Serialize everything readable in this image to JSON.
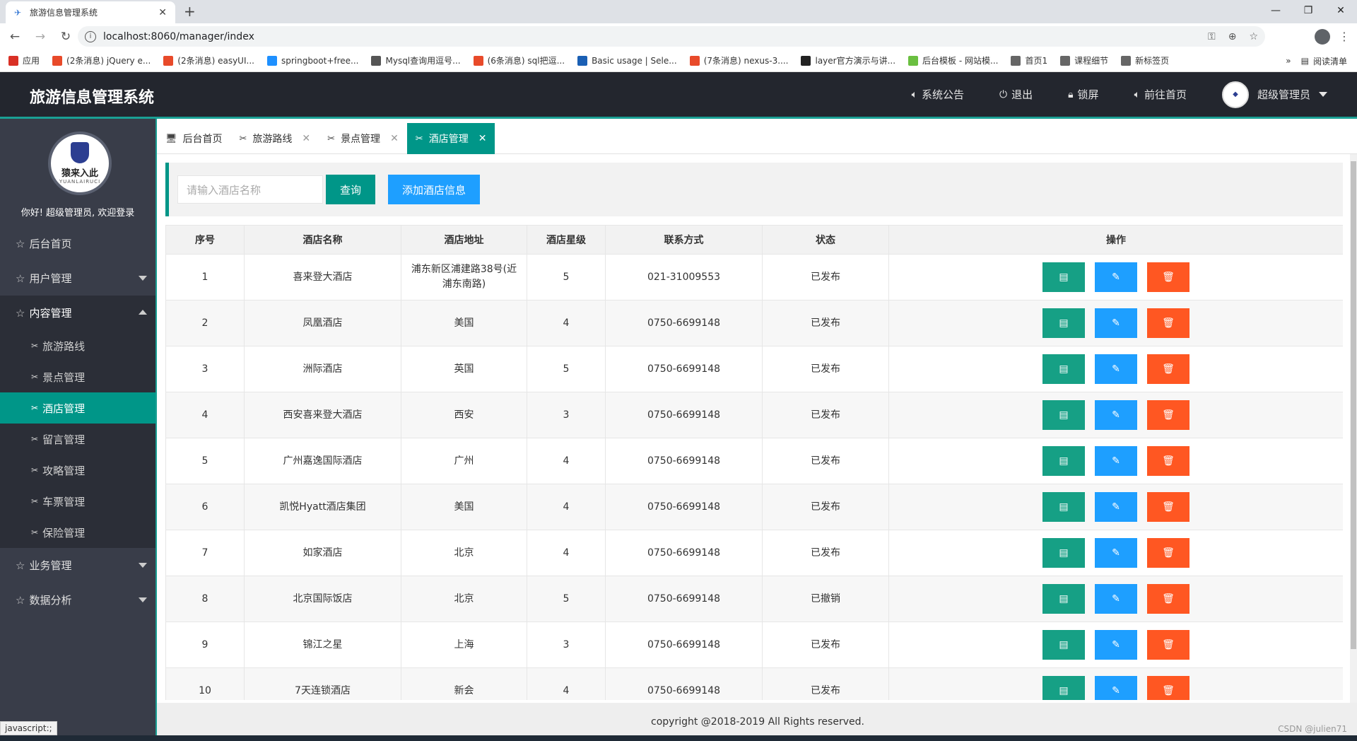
{
  "browser": {
    "tab_title": "旅游信息管理系统",
    "url": "localhost:8060/manager/index",
    "bookmarks": [
      {
        "icon": "apps-icon",
        "label": "应用",
        "color": "#d93025"
      },
      {
        "icon": "c-icon",
        "label": "(2条消息) jQuery e...",
        "color": "#e84a2a"
      },
      {
        "icon": "c-icon",
        "label": "(2条消息) easyUI...",
        "color": "#e84a2a"
      },
      {
        "icon": "tv-icon",
        "label": "springboot+free...",
        "color": "#1e90ff"
      },
      {
        "icon": "dolphin-icon",
        "label": "Mysql查询用逗号...",
        "color": "#555555"
      },
      {
        "icon": "c-icon",
        "label": "(6条消息) sql把逗...",
        "color": "#e84a2a"
      },
      {
        "icon": "stack-icon",
        "label": "Basic usage | Sele...",
        "color": "#1a5fb4"
      },
      {
        "icon": "c-icon",
        "label": "(7条消息) nexus-3....",
        "color": "#e84a2a"
      },
      {
        "icon": "layer-icon",
        "label": "layer官方演示与讲...",
        "color": "#222222"
      },
      {
        "icon": "m-icon",
        "label": "后台模板 - 网站模...",
        "color": "#6abf40"
      },
      {
        "icon": "globe-icon",
        "label": "首页1",
        "color": "#666666"
      },
      {
        "icon": "globe-icon",
        "label": "课程细节",
        "color": "#666666"
      },
      {
        "icon": "globe-icon",
        "label": "新标签页",
        "color": "#666666"
      }
    ],
    "reading_list": "阅读清单",
    "status_text": "javascript:;",
    "watermark": "CSDN @julien71"
  },
  "header": {
    "title": "旅游信息管理系统",
    "nav": [
      {
        "icon": "speaker-icon",
        "label": "系统公告"
      },
      {
        "icon": "power-icon",
        "label": "退出"
      },
      {
        "icon": "lock-icon",
        "label": "锁屏"
      },
      {
        "icon": "speaker-icon",
        "label": "前往首页"
      }
    ],
    "user": "超级管理员"
  },
  "sidebar": {
    "welcome": "你好! 超级管理员, 欢迎登录",
    "logo_text": "猿来入此",
    "logo_sub": "YUANLAIRUCI",
    "items": [
      {
        "label": "后台首页",
        "expandable": false
      },
      {
        "label": "用户管理",
        "expandable": true
      },
      {
        "label": "内容管理",
        "expandable": true,
        "open": true
      }
    ],
    "sub_items": [
      "旅游路线",
      "景点管理",
      "酒店管理",
      "留言管理",
      "攻略管理",
      "车票管理",
      "保险管理"
    ],
    "active_sub": "酒店管理",
    "bottom_items": [
      "业务管理",
      "数据分析"
    ]
  },
  "tabs": [
    {
      "label": "后台首页",
      "closable": false
    },
    {
      "label": "旅游路线",
      "closable": true
    },
    {
      "label": "景点管理",
      "closable": true
    },
    {
      "label": "酒店管理",
      "closable": true,
      "active": true
    }
  ],
  "search": {
    "placeholder": "请输入酒店名称",
    "query_label": "查询",
    "add_label": "添加酒店信息"
  },
  "table": {
    "columns": [
      "序号",
      "酒店名称",
      "酒店地址",
      "酒店星级",
      "联系方式",
      "状态",
      "操作"
    ],
    "rows": [
      [
        "1",
        "喜来登大酒店",
        "浦东新区浦建路38号(近浦东南路)",
        "5",
        "021-31009553",
        "已发布"
      ],
      [
        "2",
        "凤凰酒店",
        "美国",
        "4",
        "0750-6699148",
        "已发布"
      ],
      [
        "3",
        "洲际酒店",
        "英国",
        "5",
        "0750-6699148",
        "已发布"
      ],
      [
        "4",
        "西安喜来登大酒店",
        "西安",
        "3",
        "0750-6699148",
        "已发布"
      ],
      [
        "5",
        "广州嘉逸国际酒店",
        "广州",
        "4",
        "0750-6699148",
        "已发布"
      ],
      [
        "6",
        "凯悦Hyatt酒店集团",
        "美国",
        "4",
        "0750-6699148",
        "已发布"
      ],
      [
        "7",
        "如家酒店",
        "北京",
        "4",
        "0750-6699148",
        "已发布"
      ],
      [
        "8",
        "北京国际饭店",
        "北京",
        "5",
        "0750-6699148",
        "已撤销"
      ],
      [
        "9",
        "锦江之星",
        "上海",
        "3",
        "0750-6699148",
        "已发布"
      ],
      [
        "10",
        "7天连锁酒店",
        "新会",
        "4",
        "0750-6699148",
        "已发布"
      ]
    ]
  },
  "footer": "copyright @2018-2019 All Rights reserved.",
  "colors": {
    "accent": "#009688",
    "header_bg": "#23262e",
    "sidebar_bg": "#393d49",
    "edit": "#1e9fff",
    "delete": "#ff5722"
  }
}
